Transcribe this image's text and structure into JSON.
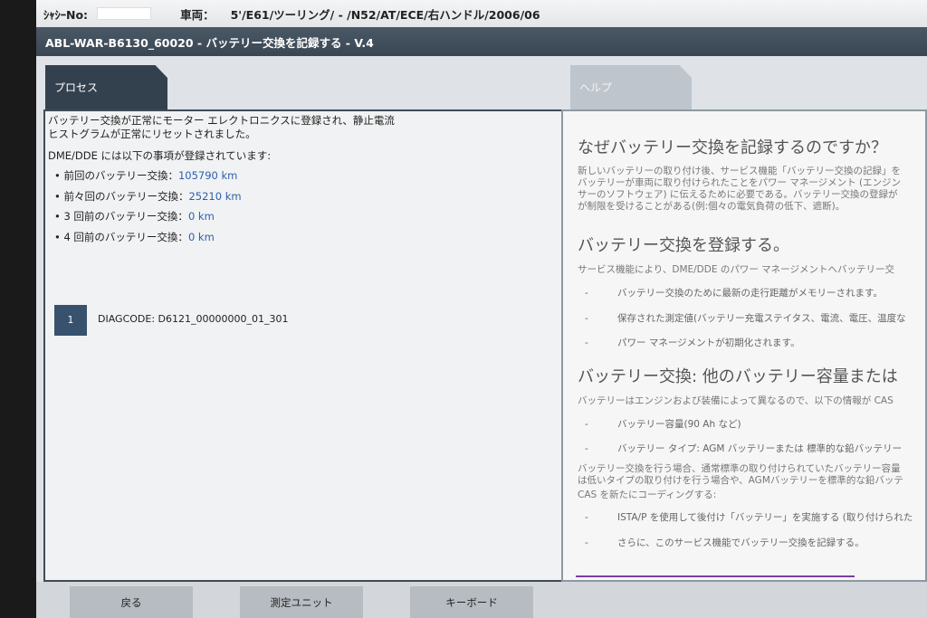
{
  "header": {
    "chassis_label": "ｼｬｼｰNo:",
    "vehicle_label": "車両：",
    "vehicle_value": "5'/E61/ツーリング/ - /N52/AT/ECE/右ハンドル/2006/06"
  },
  "title": "ABL-WAR-B6130_60020 - バッテリー交換を記録する - V.4",
  "tabs": {
    "process": "プロセス",
    "help": "ヘルプ"
  },
  "process": {
    "line1": "バッテリー交換が正常にモーター エレクトロニクスに登録され、静止電流",
    "line2": "ヒストグラムが正常にリセットされました。",
    "line3": "DME/DDE には以下の事項が登録されています:",
    "items": [
      {
        "label": "前回のバッテリー交換：",
        "value": "105790 km"
      },
      {
        "label": "前々回のバッテリー交換：",
        "value": "25210 km"
      },
      {
        "label": "3 回前のバッテリー交換：",
        "value": "0 km"
      },
      {
        "label": "4 回前のバッテリー交換：",
        "value": "0 km"
      }
    ],
    "code_index": "1",
    "diag_code": "DIAGCODE: D6121_00000000_01_301"
  },
  "help": {
    "h1": "なぜバッテリー交換を記録するのですか？",
    "p1": [
      "新しいバッテリーの取り付け後、サービス機能「バッテリー交換の記録」を",
      "バッテリーが車両に取り付けられたことをパワー マネージメント (エンジン",
      "サーのソフトウェア) に伝えるために必要である。バッテリー交換の登録が",
      "が制限を受けることがある(例:個々の電気負荷の低下、遮断)。"
    ],
    "h2": "バッテリー交換を登録する。",
    "p2": "サービス機能により、DME/DDE のパワー マネージメントへバッテリー交",
    "list2": [
      "バッテリー交換のために最新の走行距離がメモリーされます。",
      "保存された測定値(バッテリー充電ステイタス、電流、電圧、温度な",
      "パワー マネージメントが初期化されます。"
    ],
    "h3": "バッテリー交換: 他のバッテリー容量または",
    "p3": "バッテリーはエンジンおよび装備によって異なるので、以下の情報が CAS",
    "list3": [
      "バッテリー容量(90 Ah など)",
      "バッテリー タイプ: AGM バッテリーまたは 標準的な鉛バッテリー"
    ],
    "p4": [
      "バッテリー交換を行う場合、通常標準の取り付けられていたバッテリー容量",
      "は低いタイプの取り付けを行う場合や、AGMバッテリーを標準的な鉛バッテ",
      "CAS を新たにコーディングする:"
    ],
    "list4": [
      "ISTA/P を使用して後付け「バッテリー」を実施する (取り付けられた",
      "さらに、このサービス機能でバッテリー交換を記録する。"
    ]
  },
  "buttons": {
    "back": "戻る",
    "measure": "測定ユニット",
    "keyboard": "キーボード"
  },
  "colors": {
    "title_bar": "#3e4a57",
    "value_text": "#2b5fb0",
    "code_box": "#38526e"
  }
}
